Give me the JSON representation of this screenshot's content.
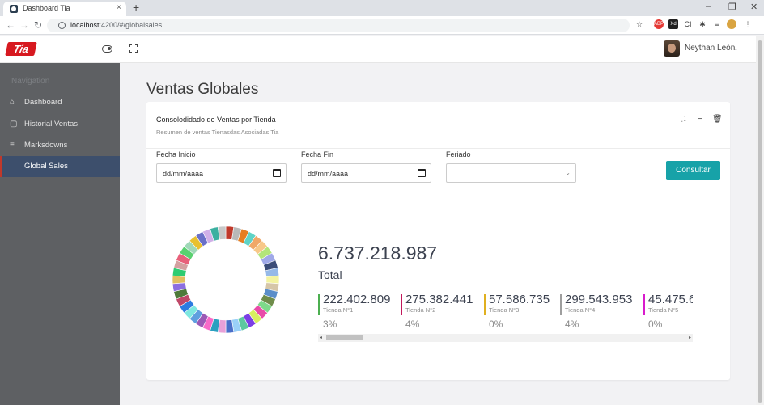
{
  "browser": {
    "tab_title": "Dashboard Tia",
    "tab_close": "×",
    "new_tab": "+",
    "url_host": "localhost",
    "url_path": ":4200/#/globalsales",
    "window_controls": [
      "–",
      "❐",
      "✕"
    ]
  },
  "header": {
    "logo_text": "Tia",
    "user_name": "Neythan León"
  },
  "sidebar": {
    "heading": "Navigation",
    "items": [
      {
        "label": "Dashboard",
        "icon": "home-icon",
        "active": false
      },
      {
        "label": "Historial Ventas",
        "icon": "document-icon",
        "active": false
      },
      {
        "label": "Marksdowns",
        "icon": "menu-icon",
        "active": false
      },
      {
        "label": "Global Sales",
        "icon": "none",
        "active": true
      }
    ]
  },
  "main": {
    "page_title": "Ventas Globales",
    "card": {
      "title": "Consolodidado de Ventas por Tienda",
      "subtitle": "Resumen de ventas Tienasdas Asociadas Tia",
      "filters": {
        "fecha_inicio_label": "Fecha Inicio",
        "fecha_inicio_value": "dd/mm/aaaa",
        "fecha_fin_label": "Fecha Fin",
        "fecha_fin_value": "dd/mm/aaaa",
        "feriado_label": "Feriado",
        "feriado_value": ""
      },
      "consultar_label": "Consultar",
      "total_value": "6.737.218.987",
      "total_label": "Total",
      "stores": [
        {
          "value": "222.402.809",
          "name": "Tienda N°1",
          "percent": "3%",
          "color": "#4caf50"
        },
        {
          "value": "275.382.441",
          "name": "Tienda N°2",
          "percent": "4%",
          "color": "#c2185b"
        },
        {
          "value": "57.586.735",
          "name": "Tienda N°3",
          "percent": "0%",
          "color": "#e0b020"
        },
        {
          "value": "299.543.953",
          "name": "Tienda N°4",
          "percent": "4%",
          "color": "#9e9e9e"
        },
        {
          "value": "45.475.6",
          "name": "Tienda N°5",
          "percent": "0%",
          "color": "#d81bcc"
        }
      ]
    }
  },
  "colors": {
    "accent": "#17a2a8",
    "sidebar": "#5e6063",
    "sidebar_active": "#3d4f6c",
    "brand_red": "#d71920"
  },
  "donut_palette": [
    "#c0392b",
    "#b8b8b8",
    "#e67e22",
    "#5fd3c6",
    "#f0a868",
    "#f7c889",
    "#b3e57a",
    "#a0a9e8",
    "#3b4c78",
    "#96b9e8",
    "#f3f3a0",
    "#d6c6a8",
    "#5b8ec9",
    "#6f8c4a",
    "#7ed98a",
    "#e84ca8",
    "#d8f060",
    "#7b3fe4",
    "#5dc8a0",
    "#9ad0f8",
    "#4a6fc9",
    "#e8a0d8",
    "#2aa0c0",
    "#f86ac8",
    "#9b59b6",
    "#5f9fdf",
    "#7ee8e0",
    "#2c7be0",
    "#c04868",
    "#4e7a3a",
    "#8c6fe0",
    "#e0c060",
    "#2ecc71",
    "#d4a0a0",
    "#e8607a",
    "#5ad070",
    "#a0d8b8",
    "#e8c030",
    "#6a70c8",
    "#d0b0e8",
    "#3bb0a0",
    "#c8c8c8"
  ]
}
